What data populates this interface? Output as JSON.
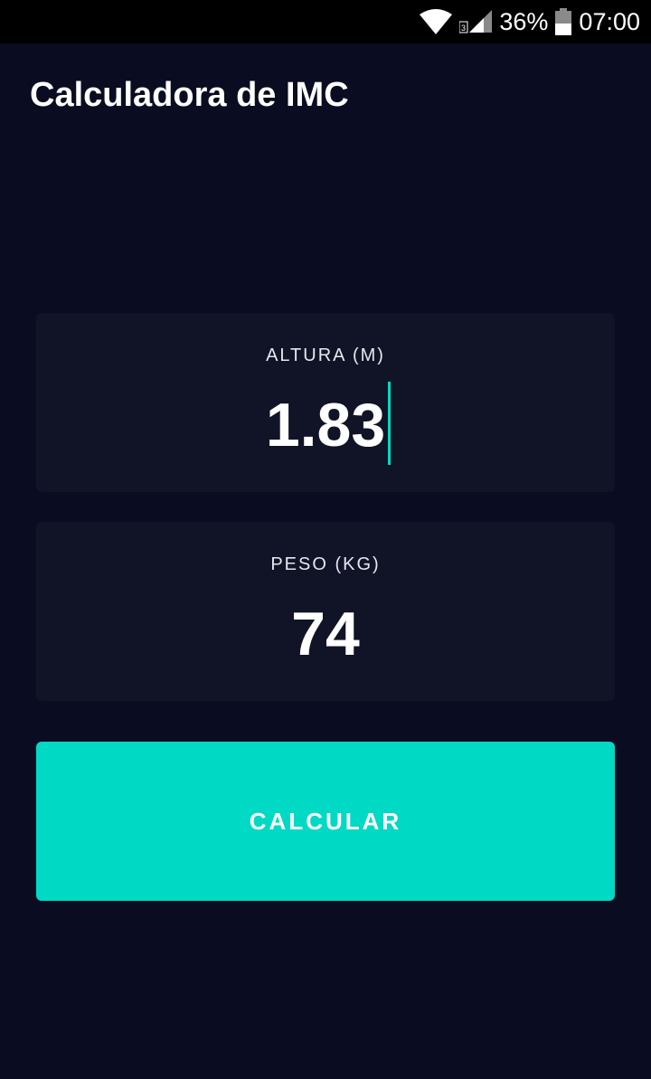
{
  "status_bar": {
    "battery_percent": "36%",
    "time": "07:00",
    "network_badge": "3",
    "icons": [
      "wifi-icon",
      "cell-signal-icon",
      "battery-icon"
    ]
  },
  "app_bar": {
    "title": "Calculadora de IMC"
  },
  "form": {
    "altura": {
      "label": "ALTURA (M)",
      "value": "1.83",
      "focused": true
    },
    "peso": {
      "label": "PESO (KG)",
      "value": "74"
    }
  },
  "actions": {
    "calculate_label": "CALCULAR"
  },
  "colors": {
    "background": "#0a0d21",
    "card": "#111427",
    "accent": "#00d9c4",
    "text": "#ffffff"
  }
}
